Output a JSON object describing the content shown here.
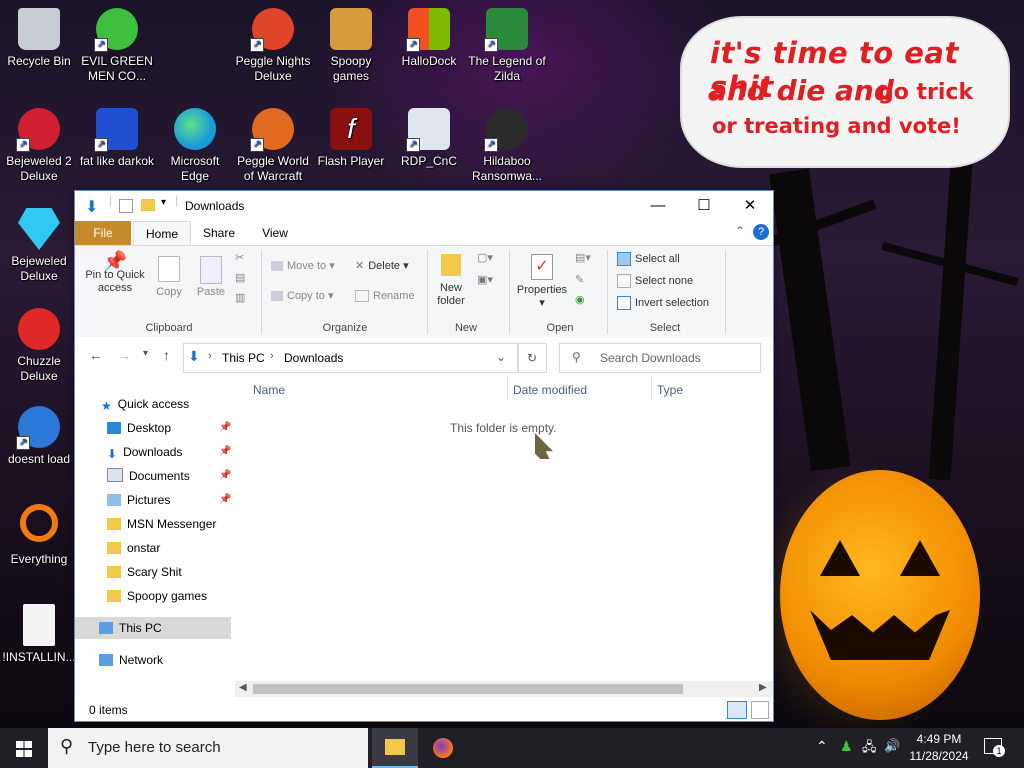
{
  "desktop": {
    "icons": [
      {
        "label": "Recycle Bin",
        "icon": "recycle-bin-icon",
        "color": "#c8ccd4"
      },
      {
        "label": "EVIL GREEN MEN CO...",
        "icon": "msn-men-icon",
        "color": "#3fbf3f"
      },
      {
        "label": "Peggle Nights Deluxe",
        "icon": "peggle-icon",
        "color": "#e0452a"
      },
      {
        "label": "Spoopy games",
        "icon": "folder-icon",
        "color": "#d89a3c"
      },
      {
        "label": "HalloDock",
        "icon": "windows-logo-icon",
        "color": "#1e90ff"
      },
      {
        "label": "The Legend of Zilda",
        "icon": "zilda-icon",
        "color": "#2a8a3a"
      },
      {
        "label": "Bejeweled 2 Deluxe",
        "icon": "bejeweled-icon",
        "color": "#d02030"
      },
      {
        "label": "fat like darkok",
        "icon": "mpl-icon",
        "color": "#2050d0"
      },
      {
        "label": "Microsoft Edge",
        "icon": "edge-icon",
        "color": "#1a9ad8"
      },
      {
        "label": "Peggle World of Warcraft",
        "icon": "peggle-icon",
        "color": "#e06a20"
      },
      {
        "label": "Flash Player",
        "icon": "flash-icon",
        "color": "#8a1010"
      },
      {
        "label": "RDP_CnC",
        "icon": "rdp-icon",
        "color": "#ffffff"
      },
      {
        "label": "Hildaboo Ransomwa...",
        "icon": "yashma-icon",
        "color": "#2a2a2a"
      },
      {
        "label": "Bejeweled Deluxe",
        "icon": "diamond-icon",
        "color": "#30c8f0"
      },
      {
        "label": "Chuzzle Deluxe",
        "icon": "chuzzle-icon",
        "color": "#e02828"
      },
      {
        "label": "doesnt load",
        "icon": "thunderbird-icon",
        "color": "#2a78d8"
      },
      {
        "label": "Everything",
        "icon": "magnifier-icon",
        "color": "#f07a10"
      },
      {
        "label": "!INSTALLIN...",
        "icon": "text-file-icon",
        "color": "#f4f4f4"
      }
    ],
    "bubble": {
      "line1": "it's time to eat shit",
      "line2a": "and die and",
      "line2b": "go trick",
      "line3": "or treating and vote!"
    }
  },
  "explorer": {
    "title": "Downloads",
    "ribbon_tabs": [
      "File",
      "Home",
      "Share",
      "View"
    ],
    "clipboard": {
      "pin": "Pin to Quick access",
      "copy": "Copy",
      "paste": "Paste",
      "group": "Clipboard"
    },
    "organize": {
      "move_to": "Move to",
      "copy_to": "Copy to",
      "delete": "Delete",
      "rename": "Rename",
      "group": "Organize"
    },
    "new": {
      "new_folder": "New folder",
      "group": "New"
    },
    "open": {
      "properties": "Properties",
      "group": "Open"
    },
    "select": {
      "select_all": "Select all",
      "select_none": "Select none",
      "invert": "Invert selection",
      "group": "Select"
    },
    "address": {
      "this_pc": "This PC",
      "downloads": "Downloads"
    },
    "search_placeholder": "Search Downloads",
    "nav": {
      "quick_access": "Quick access",
      "desktop": "Desktop",
      "downloads": "Downloads",
      "documents": "Documents",
      "pictures": "Pictures",
      "msn": "MSN Messenger",
      "onstar": "onstar",
      "scary": "Scary Shit",
      "spoopy": "Spoopy games",
      "this_pc": "This PC",
      "network": "Network"
    },
    "columns": {
      "name": "Name",
      "date": "Date modified",
      "type": "Type"
    },
    "empty_text": "This folder is empty.",
    "status": "0 items"
  },
  "taskbar": {
    "search_placeholder": "Type here to search",
    "time": "4:49 PM",
    "date": "11/28/2024",
    "notification_count": "1"
  },
  "colors": {
    "accent": "#0078d7",
    "file_tab": "#c58b2b",
    "folder": "#f2c94c"
  }
}
